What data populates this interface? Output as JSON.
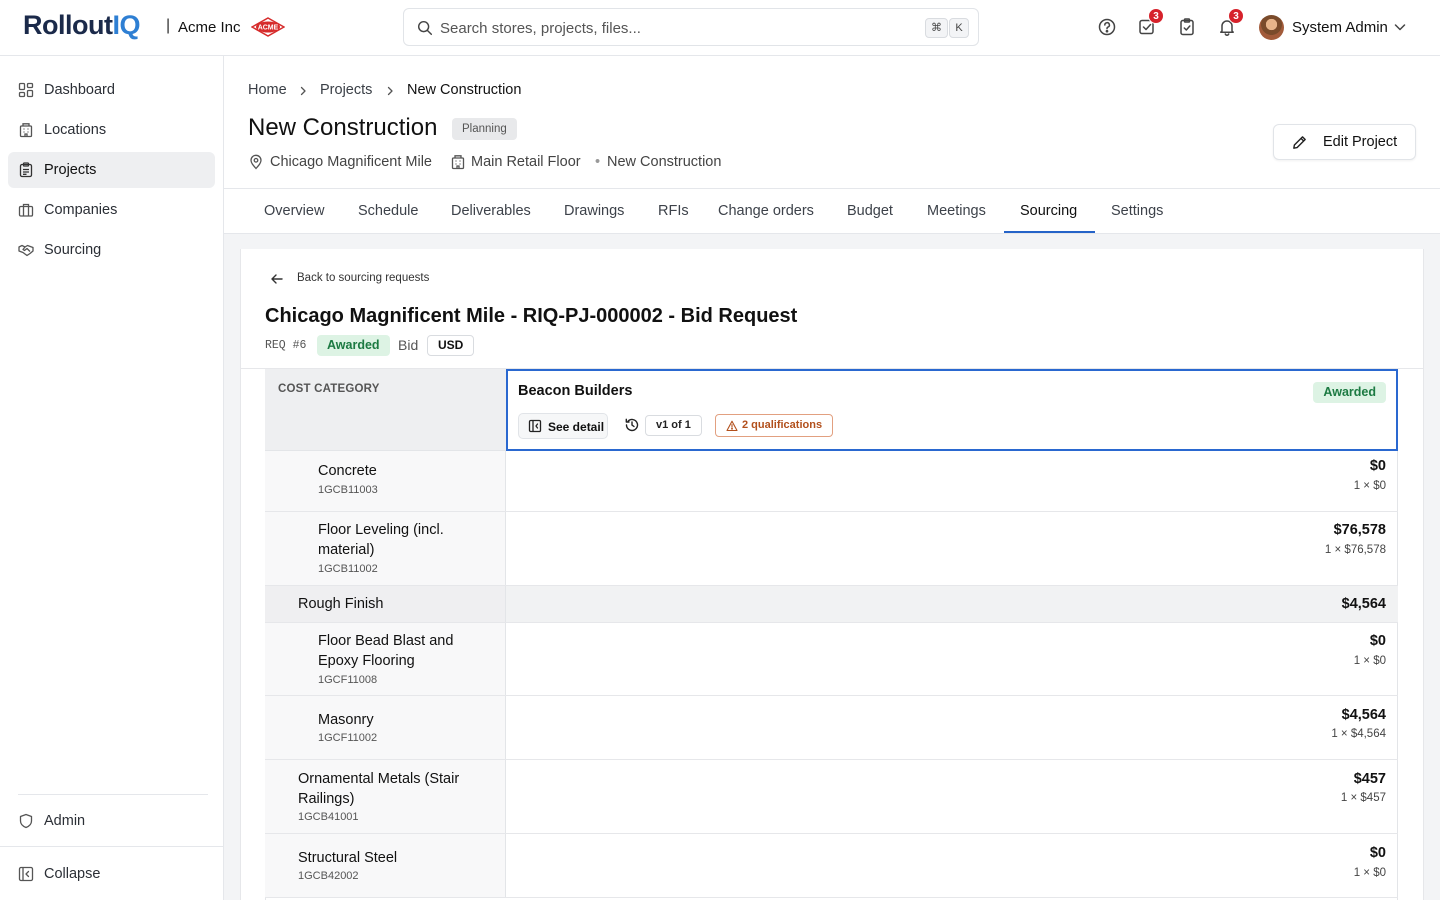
{
  "app": {
    "logo_main": "Rollout",
    "logo_accent": "IQ",
    "org_separator": "|",
    "org_name": "Acme Inc",
    "org_logo_text": "ACME",
    "brand_color": "#2e7fd3"
  },
  "search": {
    "placeholder": "Search stores, projects, files...",
    "shortcut_1": "⌘",
    "shortcut_2": "K"
  },
  "topbar": {
    "tasks_badge": "3",
    "notifications_badge": "3",
    "user_name": "System Admin"
  },
  "sidebar": {
    "items": [
      {
        "label": "Dashboard",
        "icon": "grid-icon"
      },
      {
        "label": "Locations",
        "icon": "building-icon"
      },
      {
        "label": "Projects",
        "icon": "clipboard-icon",
        "active": true
      },
      {
        "label": "Companies",
        "icon": "briefcase-icon"
      },
      {
        "label": "Sourcing",
        "icon": "handshake-icon"
      }
    ],
    "admin_label": "Admin",
    "collapse_label": "Collapse"
  },
  "breadcrumb": {
    "home": "Home",
    "projects": "Projects",
    "current": "New Construction"
  },
  "project": {
    "title": "New Construction",
    "status": "Planning",
    "location": "Chicago Magnificent Mile",
    "floor": "Main Retail Floor",
    "type": "New Construction",
    "edit_label": "Edit Project"
  },
  "tabs": [
    "Overview",
    "Schedule",
    "Deliverables",
    "Drawings",
    "RFIs",
    "Change orders",
    "Budget",
    "Meetings",
    "Sourcing",
    "Settings"
  ],
  "active_tab": "Sourcing",
  "request": {
    "back_label": "Back to sourcing requests",
    "title": "Chicago Magnificent Mile - RIQ-PJ-000002 - Bid Request",
    "req_number": "REQ #6",
    "status": "Awarded",
    "type": "Bid",
    "currency": "USD"
  },
  "table": {
    "category_header": "COST CATEGORY",
    "vendor": {
      "name": "Beacon Builders",
      "status": "Awarded",
      "see_detail_label": "See detail",
      "version": "v1 of 1",
      "qualifications": "2 qualifications"
    },
    "rows": [
      {
        "name": "Concrete",
        "code": "1GCB11003",
        "amount": "$0",
        "calc": "1 × $0",
        "level": 2
      },
      {
        "name": "Floor Leveling (incl. material)",
        "code": "1GCB11002",
        "amount": "$76,578",
        "calc": "1 × $76,578",
        "level": 2
      },
      {
        "name": "Rough Finish",
        "code": "",
        "amount": "$4,564",
        "calc": "",
        "level": 1,
        "group": true
      },
      {
        "name": "Floor Bead Blast and Epoxy Flooring",
        "code": "1GCF11008",
        "amount": "$0",
        "calc": "1 × $0",
        "level": 2
      },
      {
        "name": "Masonry",
        "code": "1GCF11002",
        "amount": "$4,564",
        "calc": "1 × $4,564",
        "level": 2
      },
      {
        "name": "Ornamental Metals (Stair Railings)",
        "code": "1GCB41001",
        "amount": "$457",
        "calc": "1 × $457",
        "level": 1
      },
      {
        "name": "Structural Steel",
        "code": "1GCB42002",
        "amount": "$0",
        "calc": "1 × $0",
        "level": 1
      }
    ]
  }
}
